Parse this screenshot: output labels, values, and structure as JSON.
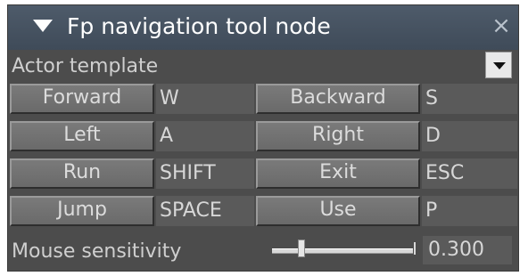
{
  "node": {
    "title": "Fp navigation tool node",
    "close_glyph": "×",
    "collapse_icon": "triangle-down-icon"
  },
  "actor_template": {
    "label": "Actor template",
    "value": ""
  },
  "bindings": [
    {
      "action": "Forward",
      "key": "W"
    },
    {
      "action": "Backward",
      "key": "S"
    },
    {
      "action": "Left",
      "key": "A"
    },
    {
      "action": "Right",
      "key": "D"
    },
    {
      "action": "Run",
      "key": "SHIFT"
    },
    {
      "action": "Exit",
      "key": "ESC"
    },
    {
      "action": "Jump",
      "key": "SPACE"
    },
    {
      "action": "Use",
      "key": "P"
    }
  ],
  "mouse_sensitivity": {
    "label": "Mouse sensitivity",
    "value_text": "0.300",
    "slider_fraction": 0.2
  },
  "colors": {
    "panel_bg": "#4c4c4c",
    "title_bg": "#4a5665",
    "button_bg": "#727272",
    "field_bg": "#5a5a5a",
    "text": "#cfcfcf"
  }
}
